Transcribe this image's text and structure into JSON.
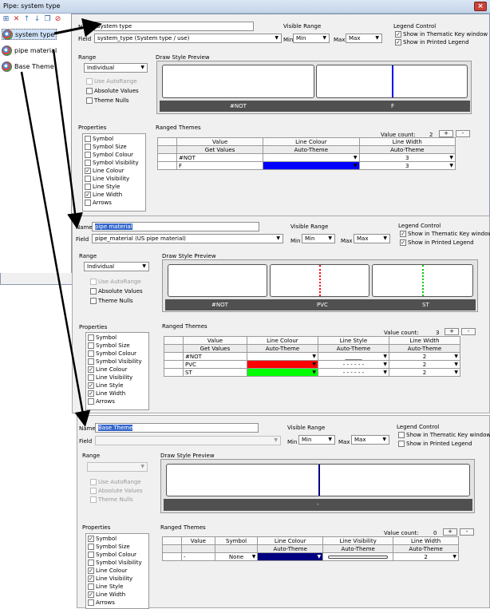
{
  "window": {
    "title": "Pipe: system type",
    "close_glyph": "×"
  },
  "tree": {
    "items": [
      {
        "label": "system type"
      },
      {
        "label": "pipe material"
      },
      {
        "label": "Base Theme"
      }
    ]
  },
  "toolbar": {
    "icons": [
      "add-icon",
      "delete-icon",
      "move-up-icon",
      "move-down-icon",
      "copy-icon",
      "clear-icon"
    ]
  },
  "labels": {
    "name": "Name",
    "field": "Field",
    "visible_range": "Visible Range",
    "min": "Min",
    "max": "Max",
    "legend_control": "Legend Control",
    "show_thematic": "Show in Thematic Key window",
    "show_printed": "Show in Printed Legend",
    "range": "Range",
    "use_autorange": "Use AutoRange",
    "absolute_values": "Absolute Values",
    "theme_nulls": "Theme Nulls",
    "draw_style_preview": "Draw Style Preview",
    "properties": "Properties",
    "ranged_themes": "Ranged Themes",
    "value_count": "Value count:",
    "plus": "+",
    "minus": "-",
    "get_values": "Get Values",
    "auto_theme": "Auto-Theme"
  },
  "properties": [
    "Symbol",
    "Symbol Size",
    "Symbol Colour",
    "Symbol Visibility",
    "Line Colour",
    "Line Visibility",
    "Line Style",
    "Line Width",
    "Arrows"
  ],
  "panels": [
    {
      "id": "system_type",
      "name": "system type",
      "field": "system_type (System type / use)",
      "min": "Min",
      "max": "Max",
      "range_mode": "Individual",
      "legend_thematic": true,
      "legend_printed": true,
      "preview": [
        "#NOT",
        "F"
      ],
      "checked": [
        "Line Colour",
        "Line Width"
      ],
      "value_count": "2",
      "columns": [
        "Value",
        "Line Colour",
        "Line Width"
      ],
      "rows": [
        {
          "value": "#NOT",
          "colour": "#ffffff",
          "width": "3"
        },
        {
          "value": "F",
          "colour": "#0000ff",
          "width": "3"
        }
      ]
    },
    {
      "id": "pipe_material",
      "name": "pipe material",
      "field": "pipe_material (US pipe material)",
      "min": "Min",
      "max": "Max",
      "range_mode": "Individual",
      "legend_thematic": true,
      "legend_printed": true,
      "preview": [
        "#NOT",
        "PVC",
        "ST"
      ],
      "checked": [
        "Line Colour",
        "Line Style",
        "Line Width"
      ],
      "value_count": "3",
      "columns": [
        "Value",
        "Line Colour",
        "Line Style",
        "Line Width"
      ],
      "rows": [
        {
          "value": "#NOT",
          "colour": "#ffffff",
          "style": "______",
          "width": "2"
        },
        {
          "value": "PVC",
          "colour": "#ff0000",
          "style": "- - - - - -",
          "width": "2"
        },
        {
          "value": "ST",
          "colour": "#00ff00",
          "style": "- - - - - -",
          "width": "2"
        }
      ]
    },
    {
      "id": "base_theme",
      "name": "Base Theme",
      "field": "",
      "min": "Min",
      "max": "Max",
      "range_mode": "",
      "legend_thematic": false,
      "legend_printed": false,
      "preview": [
        "-"
      ],
      "checked": [
        "Symbol",
        "Line Colour",
        "Line Visibility",
        "Line Width"
      ],
      "value_count": "0",
      "columns": [
        "Value",
        "Symbol",
        "Line Colour",
        "Line Visibility",
        "Line Width"
      ],
      "rows": [
        {
          "value": "-",
          "symbol": "None",
          "colour": "#000080",
          "width": "2"
        }
      ]
    }
  ],
  "colors": {
    "system_F": "#0000ff",
    "pvc": "#ff0000",
    "st": "#00ff00",
    "base": "#000080"
  }
}
